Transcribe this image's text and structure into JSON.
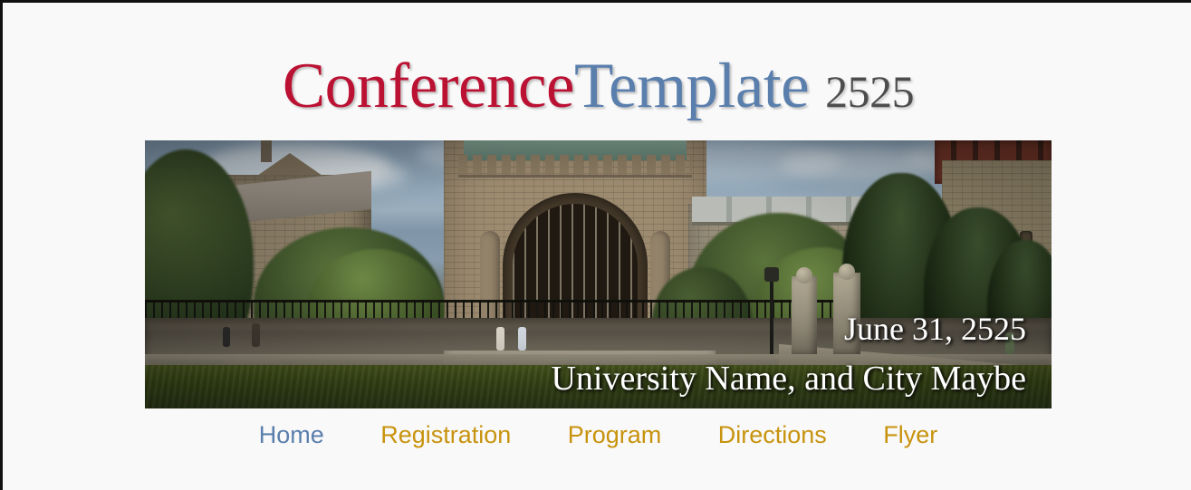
{
  "site": {
    "title_part1": "Conference",
    "title_part2": "Template",
    "title_year": "2525"
  },
  "hero": {
    "alt": "university-gothic-library-campus-photo",
    "date": "June 31, 2525",
    "location": "University Name, and City Maybe"
  },
  "nav": {
    "items": [
      {
        "label": "Home",
        "active": true
      },
      {
        "label": "Registration",
        "active": false
      },
      {
        "label": "Program",
        "active": false
      },
      {
        "label": "Directions",
        "active": false
      },
      {
        "label": "Flyer",
        "active": false
      }
    ]
  },
  "colors": {
    "title_red": "#bb1133",
    "title_blue": "#5b7fad",
    "year_gray": "#4d4d4d",
    "nav_gold": "#c8930e",
    "nav_active_blue": "#5b7fad",
    "page_background": "#f9f9f9"
  }
}
